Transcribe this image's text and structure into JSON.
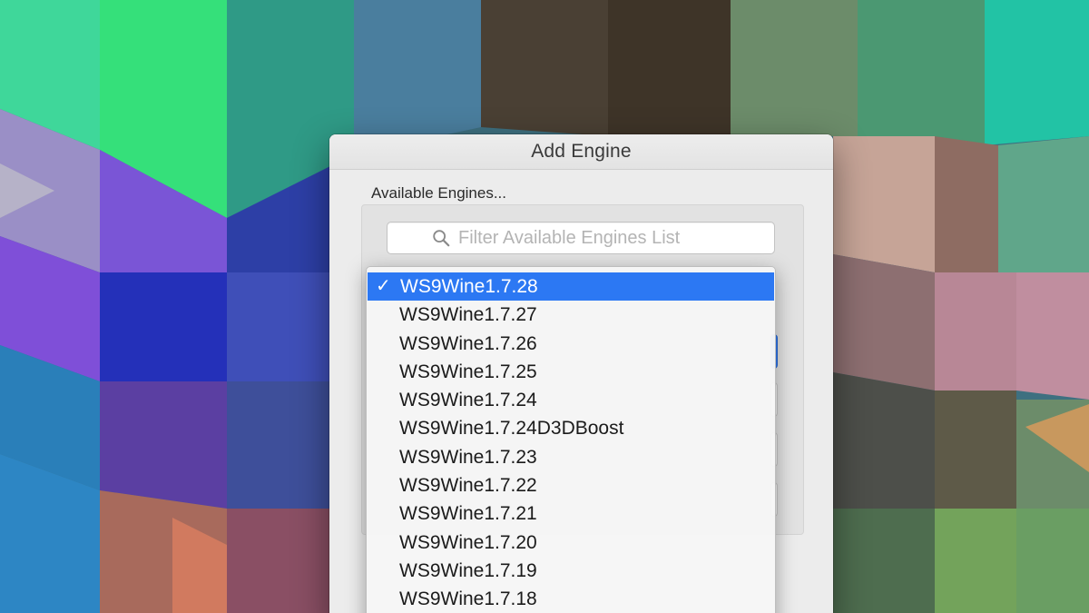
{
  "dialog": {
    "title": "Add Engine",
    "section_label": "Available Engines..."
  },
  "search": {
    "placeholder": "Filter Available Engines List",
    "value": "",
    "icon": "search-icon"
  },
  "engines": {
    "selected": "WS9Wine1.7.28",
    "items": [
      "WS9Wine1.7.28",
      "WS9Wine1.7.27",
      "WS9Wine1.7.26",
      "WS9Wine1.7.25",
      "WS9Wine1.7.24",
      "WS9Wine1.7.24D3DBoost",
      "WS9Wine1.7.23",
      "WS9Wine1.7.22",
      "WS9Wine1.7.21",
      "WS9Wine1.7.20",
      "WS9Wine1.7.19",
      "WS9Wine1.7.18"
    ],
    "check_glyph": "✓"
  },
  "colors": {
    "selection": "#2c78f3",
    "dialog_bg": "#ececec",
    "text": "#1b1b1b"
  }
}
